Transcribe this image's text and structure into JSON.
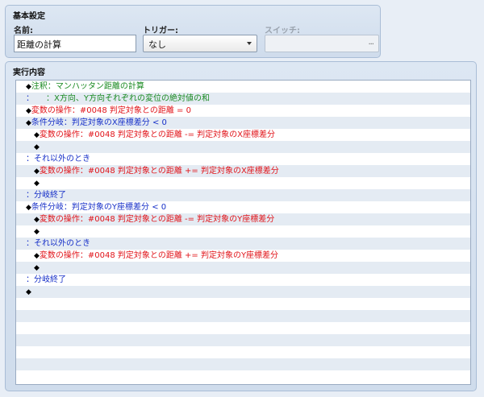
{
  "basic_settings": {
    "title": "基本設定",
    "name_label": "名前:",
    "name_value": "距離の計算",
    "trigger_label": "トリガー:",
    "trigger_value": "なし",
    "switch_label": "スイッチ:",
    "switch_button": "..."
  },
  "contents": {
    "title": "実行内容",
    "rows": [
      {
        "indent": 1,
        "prefix": "◆",
        "segments": [
          {
            "text": "注釈：マンハッタン距離の計算",
            "cls": "c-comment"
          }
        ]
      },
      {
        "indent": 1,
        "prefix": "：",
        "segments": [
          {
            "text": "　　：X方向、Y方向それぞれの変位の絶対値の和",
            "cls": "c-comment"
          }
        ]
      },
      {
        "indent": 1,
        "prefix": "◆",
        "segments": [
          {
            "text": "変数の操作：#0048 判定対象との距離 = 0",
            "cls": "c-var"
          }
        ]
      },
      {
        "indent": 1,
        "prefix": "◆",
        "segments": [
          {
            "text": "条件分岐：判定対象のX座標差分 < 0",
            "cls": "c-cond"
          }
        ]
      },
      {
        "indent": 2,
        "prefix": "◆",
        "segments": [
          {
            "text": "変数の操作：#0048 判定対象との距離 -= 判定対象のX座標差分",
            "cls": "c-var"
          }
        ]
      },
      {
        "indent": 2,
        "prefix": "◆",
        "segments": []
      },
      {
        "indent": 1,
        "prefix": "：",
        "segments": [
          {
            "text": "それ以外のとき",
            "cls": "c-plain"
          }
        ]
      },
      {
        "indent": 2,
        "prefix": "◆",
        "segments": [
          {
            "text": "変数の操作：#0048 判定対象との距離 += 判定対象のX座標差分",
            "cls": "c-var"
          }
        ]
      },
      {
        "indent": 2,
        "prefix": "◆",
        "segments": []
      },
      {
        "indent": 1,
        "prefix": "：",
        "segments": [
          {
            "text": "分岐終了",
            "cls": "c-plain"
          }
        ]
      },
      {
        "indent": 1,
        "prefix": "◆",
        "segments": [
          {
            "text": "条件分岐：判定対象のY座標差分 < 0",
            "cls": "c-cond"
          }
        ]
      },
      {
        "indent": 2,
        "prefix": "◆",
        "segments": [
          {
            "text": "変数の操作：#0048 判定対象との距離 -= 判定対象のY座標差分",
            "cls": "c-var"
          }
        ]
      },
      {
        "indent": 2,
        "prefix": "◆",
        "segments": []
      },
      {
        "indent": 1,
        "prefix": "：",
        "segments": [
          {
            "text": "それ以外のとき",
            "cls": "c-plain"
          }
        ]
      },
      {
        "indent": 2,
        "prefix": "◆",
        "segments": [
          {
            "text": "変数の操作：#0048 判定対象との距離 += 判定対象のY座標差分",
            "cls": "c-var"
          }
        ]
      },
      {
        "indent": 2,
        "prefix": "◆",
        "segments": []
      },
      {
        "indent": 1,
        "prefix": "：",
        "segments": [
          {
            "text": "分岐終了",
            "cls": "c-plain"
          }
        ]
      },
      {
        "indent": 1,
        "prefix": "◆",
        "segments": []
      }
    ],
    "empty_rows": 7
  },
  "colors": {
    "comment": "#1a8a22",
    "variable": "#e1141a",
    "condition": "#1730c8",
    "panel_bg": "#dde7f3",
    "row_alt": "#e4ebf3"
  }
}
